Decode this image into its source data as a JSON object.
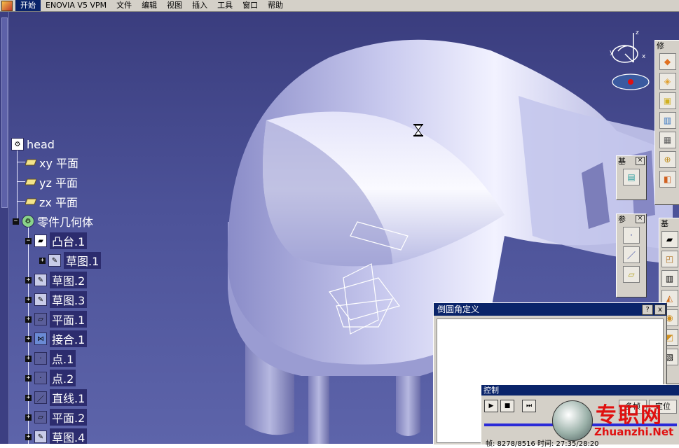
{
  "menu": [
    "开始",
    "ENOVIA V5 VPM",
    "文件",
    "编辑",
    "视图",
    "插入",
    "工具",
    "窗口",
    "帮助"
  ],
  "compass": {
    "z_label": "z",
    "x_label": "x",
    "y_label": "y"
  },
  "tree": {
    "root": "head",
    "nodes": [
      {
        "label": "xy 平面",
        "icon": "plane-icon"
      },
      {
        "label": "yz 平面",
        "icon": "plane-icon"
      },
      {
        "label": "zx 平面",
        "icon": "plane-icon"
      },
      {
        "label": "零件几何体",
        "icon": "gear-icon"
      },
      {
        "label": "凸台.1",
        "icon": "pad-icon"
      },
      {
        "label": "草图.1",
        "icon": "sketch-icon"
      },
      {
        "label": "草图.2",
        "icon": "sketch-icon"
      },
      {
        "label": "草图.3",
        "icon": "sketch-icon"
      },
      {
        "label": "平面.1",
        "icon": "plane-icon"
      },
      {
        "label": "接合.1",
        "icon": "join-icon"
      },
      {
        "label": "点.1",
        "icon": "point-icon"
      },
      {
        "label": "点.2",
        "icon": "point-icon"
      },
      {
        "label": "直线.1",
        "icon": "line-icon"
      },
      {
        "label": "平面.2",
        "icon": "plane-icon"
      },
      {
        "label": "草图.4",
        "icon": "sketch-icon"
      }
    ]
  },
  "toolbars": {
    "modify_title": "修",
    "base_title": "基",
    "ref_title": "参",
    "base2_title": "基"
  },
  "dialog": {
    "title": "倒圆角定义",
    "help": "?",
    "close": "x"
  },
  "control": {
    "title": "控制",
    "btn_left": "多帧",
    "btn_right": "定位",
    "status": "帧: 8278/8516 时间: 27:35/28:20"
  },
  "watermark": {
    "cn": "专职网",
    "en": "Zhuanzhi.Net"
  },
  "colors": {
    "menu_active": "#0a246a",
    "viewport": "#4c5298",
    "watermark": "#e01010"
  }
}
